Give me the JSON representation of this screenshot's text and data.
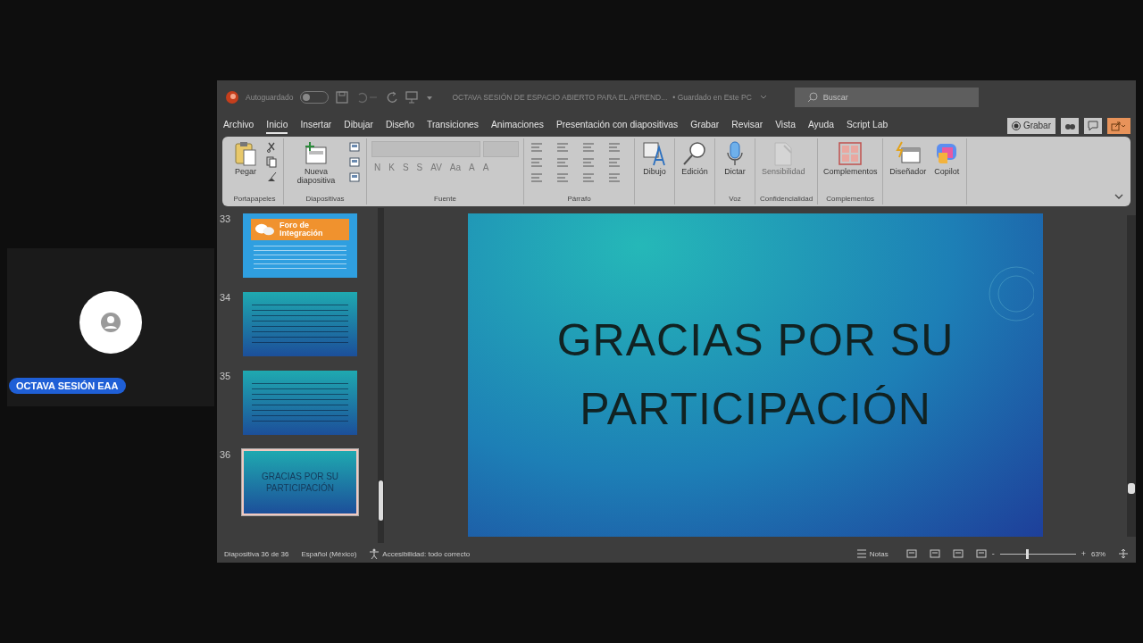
{
  "participant": {
    "name": "OCTAVA SESIÓN EAA"
  },
  "title_bar": {
    "autosave_label": "Autoguardado",
    "autosave_on": false,
    "document_title": "OCTAVA SESIÓN DE ESPACIO ABIERTO PARA EL APREND...",
    "save_status": "• Guardado en Este PC",
    "search_placeholder": "Buscar"
  },
  "menu_tabs": [
    {
      "label": "Archivo",
      "selected": false
    },
    {
      "label": "Inicio",
      "selected": true
    },
    {
      "label": "Insertar",
      "selected": false
    },
    {
      "label": "Dibujar",
      "selected": false
    },
    {
      "label": "Diseño",
      "selected": false
    },
    {
      "label": "Transiciones",
      "selected": false
    },
    {
      "label": "Animaciones",
      "selected": false
    },
    {
      "label": "Presentación con diapositivas",
      "selected": false
    },
    {
      "label": "Grabar",
      "selected": false
    },
    {
      "label": "Revisar",
      "selected": false
    },
    {
      "label": "Vista",
      "selected": false
    },
    {
      "label": "Ayuda",
      "selected": false
    },
    {
      "label": "Script Lab",
      "selected": false
    }
  ],
  "record_button": {
    "label": "Grabar"
  },
  "ribbon_groups": [
    {
      "label": "Portapapeles",
      "items": [
        {
          "kind": "paste",
          "label": "Pegar",
          "disabled": false
        }
      ],
      "kind": "clipboard"
    },
    {
      "label": "Diapositivas",
      "items": [
        {
          "kind": "new-slide",
          "label": "Nueva diapositiva",
          "disabled": false
        }
      ],
      "kind": "slides"
    },
    {
      "label": "Fuente",
      "kind": "font",
      "format_buttons": [
        "N",
        "K",
        "S",
        "S",
        "AV",
        "Aa",
        "A",
        "A"
      ]
    },
    {
      "label": "Párrafo",
      "kind": "paragraph"
    },
    {
      "items": [
        {
          "kind": "shape",
          "label": "Dibujo",
          "disabled": false
        }
      ]
    },
    {
      "items": [
        {
          "kind": "search",
          "label": "Edición",
          "disabled": false
        }
      ]
    },
    {
      "label": "Voz",
      "items": [
        {
          "kind": "mic",
          "label": "Dictar",
          "disabled": false
        }
      ]
    },
    {
      "label": "Confidencialidad",
      "items": [
        {
          "kind": "sensitivity",
          "label": "Sensibilidad",
          "disabled": true
        }
      ]
    },
    {
      "label": "Complementos",
      "items": [
        {
          "kind": "addins",
          "label": "Complementos",
          "disabled": false
        }
      ]
    },
    {
      "items": [
        {
          "kind": "designer",
          "label": "Diseñador",
          "disabled": false
        },
        {
          "kind": "copilot",
          "label": "Copilot",
          "disabled": false
        }
      ]
    }
  ],
  "slides": [
    {
      "number": "33",
      "kind": "forum",
      "title": "Foro de Integración",
      "selected": false
    },
    {
      "number": "34",
      "kind": "list",
      "selected": false
    },
    {
      "number": "35",
      "kind": "text",
      "selected": false
    },
    {
      "number": "36",
      "kind": "title",
      "title": "GRACIAS POR SU PARTICIPACIÓN",
      "selected": true
    }
  ],
  "current_slide": {
    "title": "GRACIAS POR SU PARTICIPACIÓN"
  },
  "status_bar": {
    "slide_info": "Diapositiva 36 de 36",
    "language": "Español (México)",
    "accessibility": "Accesibilidad: todo correcto",
    "notes": "Notas",
    "zoom": "63%",
    "zoom_out": "-",
    "zoom_in": "+",
    "zoom_slider": {
      "level": 0.35
    }
  }
}
